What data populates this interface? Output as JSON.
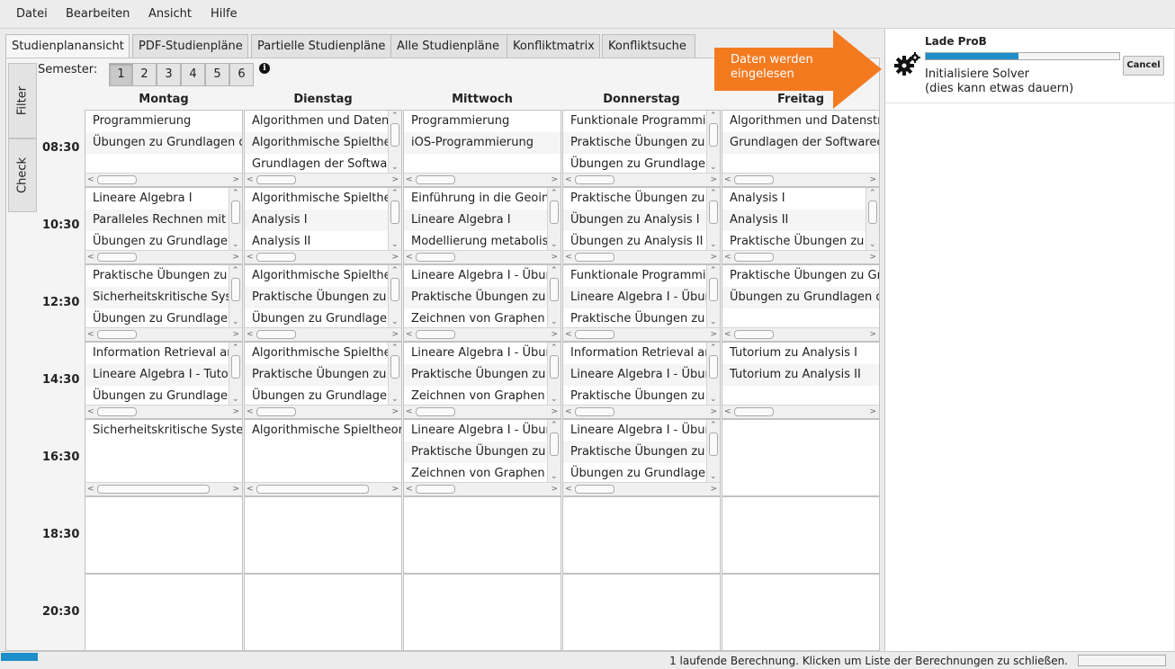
{
  "menu": [
    "Datei",
    "Bearbeiten",
    "Ansicht",
    "Hilfe"
  ],
  "tabs": [
    "Studienplanansicht",
    "PDF-Studienpläne",
    "Partielle Studienpläne",
    "Alle Studienpläne",
    "Konfliktmatrix",
    "Konfliktsuche"
  ],
  "active_tab": "Studienplanansicht",
  "side_tabs": [
    "Filter",
    "Check"
  ],
  "semester": {
    "label": "Semester:",
    "options": [
      "1",
      "2",
      "3",
      "4",
      "5",
      "6"
    ],
    "selected": "1"
  },
  "days": [
    "Montag",
    "Dienstag",
    "Mittwoch",
    "Donnerstag",
    "Freitag"
  ],
  "times": [
    "08:30",
    "10:30",
    "12:30",
    "14:30",
    "16:30",
    "18:30",
    "20:30"
  ],
  "schedule": [
    [
      [
        "Programmierung",
        "Übungen zu Grundlagen d"
      ],
      [
        "Algorithmen und Datenstr",
        "Algorithmische Spieltheor",
        "Grundlagen der Softwaret"
      ],
      [
        "Programmierung",
        "iOS-Programmierung"
      ],
      [
        "Funktionale Programmier",
        "Praktische Übungen zu",
        "Übungen zu Grundlagen"
      ],
      [
        "Algorithmen und Datenstru",
        "Grundlagen der Softwareer"
      ]
    ],
    [
      [
        "Lineare Algebra I",
        "Paralleles Rechnen mit",
        "Übungen zu Grundlagen"
      ],
      [
        "Algorithmische Spieltheor",
        "Analysis I",
        "Analysis II"
      ],
      [
        "Einführung in die Geoinf",
        "Lineare Algebra I",
        "Modellierung metabolisch"
      ],
      [
        "Praktische Übungen zu",
        "Übungen zu Analysis I",
        "Übungen zu Analysis II"
      ],
      [
        "Analysis I",
        "Analysis II",
        "Praktische Übungen zu"
      ]
    ],
    [
      [
        "Praktische Übungen zu",
        "Sicherheitskritische Syst",
        "Übungen zu Grundlagen"
      ],
      [
        "Algorithmische Spieltheor",
        "Praktische Übungen zu",
        "Übungen zu Grundlagen"
      ],
      [
        "Lineare Algebra I - Übun",
        "Praktische Übungen zu",
        "Zeichnen von Graphen"
      ],
      [
        "Funktionale Programmier",
        "Lineare Algebra I - Übun",
        "Praktische Übungen zu"
      ],
      [
        "Praktische Übungen zu Gru",
        "Übungen zu Grundlagen d"
      ]
    ],
    [
      [
        "Information Retrieval an",
        "Lineare Algebra I - Tuto",
        "Übungen zu Grundlagen"
      ],
      [
        "Algorithmische Spieltheor",
        "Praktische Übungen zu",
        "Übungen zu Grundlagen"
      ],
      [
        "Lineare Algebra I - Übun",
        "Praktische Übungen zu",
        "Zeichnen von Graphen"
      ],
      [
        "Information Retrieval an",
        "Lineare Algebra I - Übun",
        "Praktische Übungen zu"
      ],
      [
        "Tutorium zu Analysis I",
        "Tutorium zu Analysis II"
      ]
    ],
    [
      [
        "Sicherheitskritische Syste"
      ],
      [
        "Algorithmische Spieltheori"
      ],
      [
        "Lineare Algebra I - Übun",
        "Praktische Übungen zu",
        "Zeichnen von Graphen"
      ],
      [
        "Lineare Algebra I - Übun",
        "Praktische Übungen zu",
        "Übungen zu Grundlagen"
      ],
      []
    ],
    [
      [],
      [],
      [],
      [],
      []
    ],
    [
      [],
      [],
      [],
      [],
      []
    ]
  ],
  "callout": {
    "text": "Daten werden eingelesen",
    "color": "#f47a20"
  },
  "prob": {
    "title": "Lade ProB",
    "progress": 0.48,
    "status_line1": "Initialisiere Solver",
    "status_line2": "(dies kann etwas dauern)",
    "cancel_label": "Cancel",
    "icon": "gears-icon"
  },
  "statusbar": {
    "text": "1 laufende Berechnung. Klicken um Liste der Berechnungen zu schließen.",
    "progress": 0.43
  },
  "accent_color": "#1f8ec9"
}
